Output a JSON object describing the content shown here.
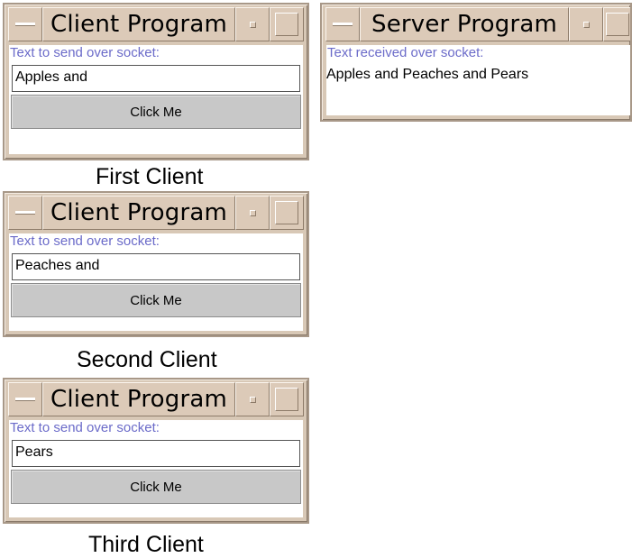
{
  "clients": [
    {
      "title": "Client Program",
      "prompt": "Text to send over socket:",
      "input_value": "Apples and",
      "button_label": "Click Me",
      "caption": "First Client"
    },
    {
      "title": "Client Program",
      "prompt": "Text to send over socket:",
      "input_value": "Peaches and",
      "button_label": "Click Me",
      "caption": "Second Client"
    },
    {
      "title": "Client Program",
      "prompt": "Text to send over socket:",
      "input_value": "Pears",
      "button_label": "Click Me",
      "caption": "Third Client"
    }
  ],
  "server": {
    "title": "Server Program",
    "prompt": "Text received over socket:",
    "received_text": "Apples and Peaches and Pears"
  }
}
